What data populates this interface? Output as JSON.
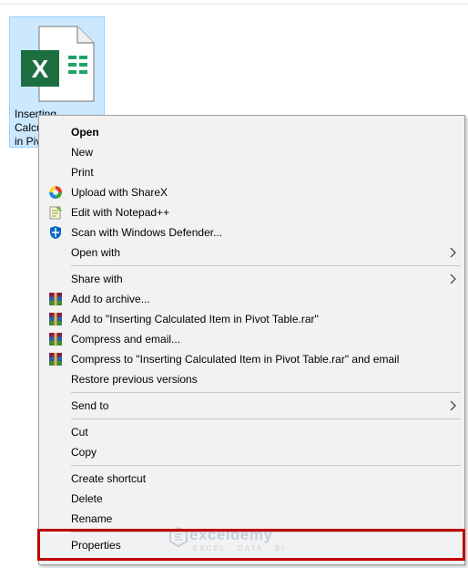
{
  "desktop": {
    "file": {
      "label_lines": [
        "Inserting",
        "Calcu",
        "in Piv"
      ]
    }
  },
  "context_menu": {
    "items": [
      {
        "label": "Open",
        "bold": true
      },
      {
        "label": "New"
      },
      {
        "label": "Print"
      },
      {
        "label": "Upload with ShareX",
        "icon": "sharex-icon"
      },
      {
        "label": "Edit with Notepad++",
        "icon": "notepad-plus-plus-icon"
      },
      {
        "label": "Scan with Windows Defender...",
        "icon": "windows-defender-icon"
      },
      {
        "label": "Open with",
        "submenu": true
      },
      {
        "label": "Share with",
        "submenu": true
      },
      {
        "label": "Add to archive...",
        "icon": "winrar-icon"
      },
      {
        "label": "Add to \"Inserting Calculated Item in Pivot Table.rar\"",
        "icon": "winrar-icon"
      },
      {
        "label": "Compress and email...",
        "icon": "winrar-icon"
      },
      {
        "label": "Compress to \"Inserting Calculated Item in Pivot Table.rar\" and email",
        "icon": "winrar-icon"
      },
      {
        "label": "Restore previous versions"
      },
      {
        "label": "Send to",
        "submenu": true
      },
      {
        "label": "Cut"
      },
      {
        "label": "Copy"
      },
      {
        "label": "Create shortcut"
      },
      {
        "label": "Delete"
      },
      {
        "label": "Rename"
      },
      {
        "label": "Properties"
      }
    ]
  },
  "watermark": {
    "title": "exceldemy",
    "subtitle": "EXCEL · DATA · BI"
  },
  "colors": {
    "excel_green": "#1d6f42",
    "highlight_red": "#c00000",
    "selection_blue": "#cce8ff"
  }
}
